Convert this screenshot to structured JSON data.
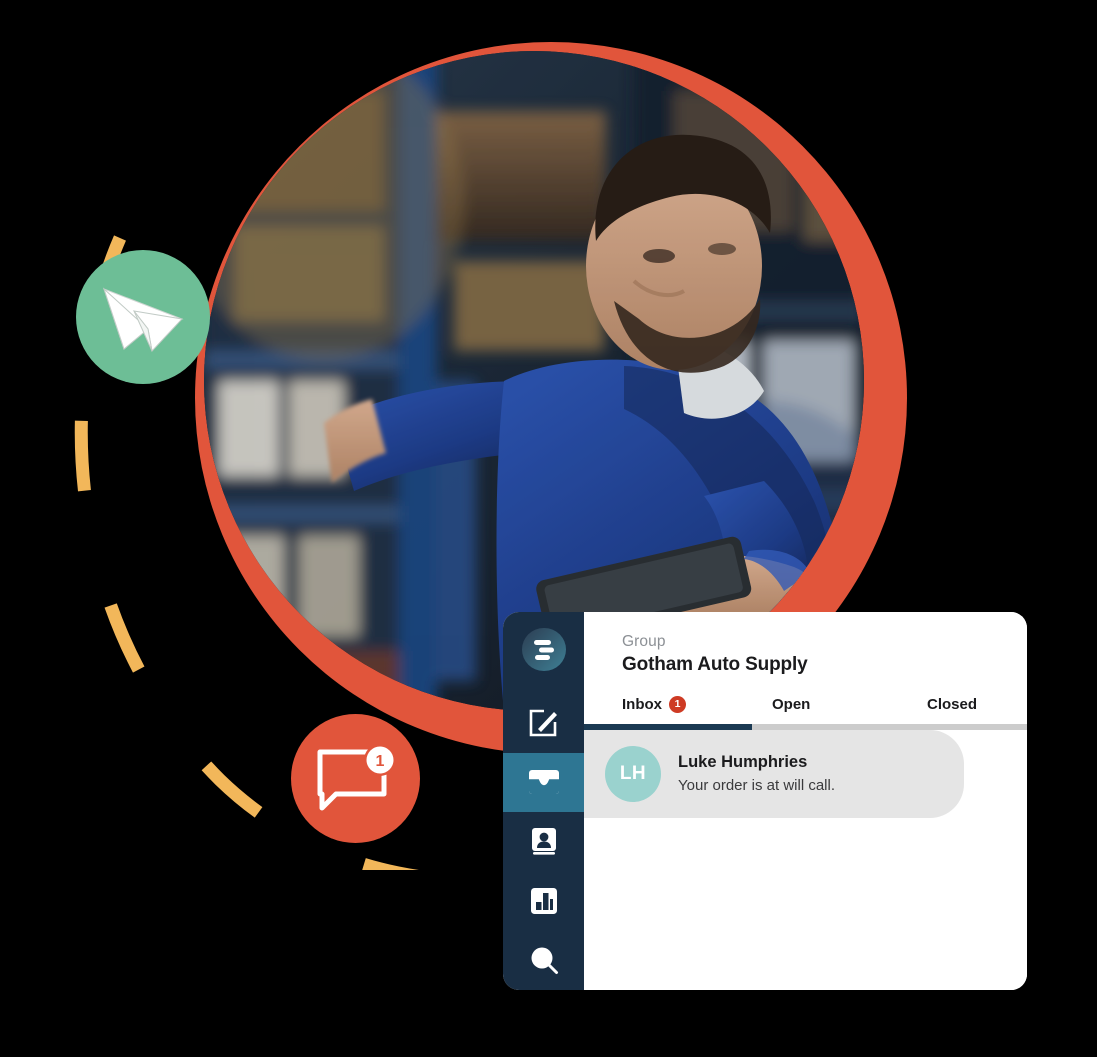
{
  "theme": {
    "background": "#000000",
    "accent_orange": "#E1553B",
    "accent_green": "#6DBE96",
    "accent_yellow": "#F5B košt",
    "dash_yellow": "#F2B75A",
    "sidebar_navy": "#192E44",
    "sidebar_active_teal": "#2E7693",
    "badge_red": "#CE3B24",
    "avatar_teal": "#9AD2CE",
    "card_gray": "#E5E5E5",
    "rail_gray": "#CCCCCC",
    "rail_active_navy": "#1B3A53"
  },
  "decorations": {
    "paper_plane_badge": {
      "icon": "paper-plane-icon",
      "circle_color": "#6DBE96"
    },
    "chat_badge": {
      "icon": "chat-bubble-icon",
      "circle_color": "#E1553B",
      "count": "1"
    },
    "dashed_arc": {
      "color": "#F2B75A",
      "dash_count": 5
    },
    "hero_photo": {
      "alt": "warehouse-worker-with-tablet",
      "ring_color": "#E1553B"
    }
  },
  "app": {
    "sidebar": {
      "logo": {
        "icon": "brand-logo-icon"
      },
      "items": [
        {
          "icon": "compose-icon",
          "name": "compose",
          "active": false
        },
        {
          "icon": "inbox-icon",
          "name": "inbox",
          "active": true
        },
        {
          "icon": "contacts-icon",
          "name": "contacts",
          "active": false
        },
        {
          "icon": "reports-icon",
          "name": "reports",
          "active": false
        },
        {
          "icon": "search-icon",
          "name": "search",
          "active": false
        }
      ]
    },
    "header": {
      "eyebrow": "Group",
      "title": "Gotham Auto Supply"
    },
    "tabs": [
      {
        "label": "Inbox",
        "badge": "1",
        "active": true
      },
      {
        "label": "Open",
        "badge": "",
        "active": false
      },
      {
        "label": "Closed",
        "badge": "",
        "active": false
      }
    ],
    "messages": [
      {
        "initials": "LH",
        "name": "Luke Humphries",
        "preview": "Your order is at will call."
      }
    ]
  }
}
